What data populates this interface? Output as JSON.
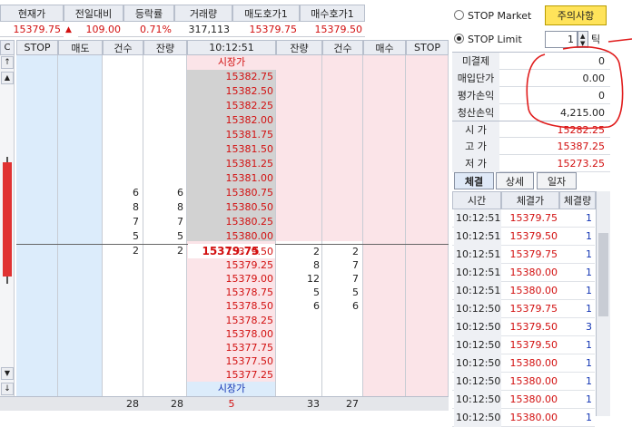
{
  "summary": {
    "headers": [
      "현재가",
      "전일대비",
      "등락률",
      "거래량",
      "매도호가1",
      "매수호가1"
    ],
    "current_price": "15379.75",
    "change_arrow": "▲",
    "change": "109.00",
    "change_rate": "0.71%",
    "volume": "317,113",
    "ask1": "15379.75",
    "bid1": "15379.50"
  },
  "controls": {
    "stop_market": "STOP Market",
    "stop_limit": "STOP Limit",
    "notice_button": "주의사항",
    "tick_value": "1",
    "tick_unit": "틱"
  },
  "orderbook": {
    "c_button": "C",
    "columns": [
      "STOP",
      "매도",
      "건수",
      "잔량",
      "10:12:51",
      "잔량",
      "건수",
      "매수",
      "STOP"
    ],
    "market_price_top": "시장가",
    "market_price_bottom": "시장가",
    "ask_rows": [
      {
        "price": "15382.75",
        "count": "",
        "qty": ""
      },
      {
        "price": "15382.50",
        "count": "",
        "qty": ""
      },
      {
        "price": "15382.25",
        "count": "",
        "qty": ""
      },
      {
        "price": "15382.00",
        "count": "",
        "qty": ""
      },
      {
        "price": "15381.75",
        "count": "",
        "qty": ""
      },
      {
        "price": "15381.50",
        "count": "",
        "qty": ""
      },
      {
        "price": "15381.25",
        "count": "",
        "qty": ""
      },
      {
        "price": "15381.00",
        "count": "",
        "qty": ""
      },
      {
        "price": "15380.75",
        "count": "6",
        "qty": "6"
      },
      {
        "price": "15380.50",
        "count": "8",
        "qty": "8"
      },
      {
        "price": "15380.25",
        "count": "7",
        "qty": "7"
      },
      {
        "price": "15380.00",
        "count": "5",
        "qty": "5"
      },
      {
        "price": "15379.75",
        "count": "2",
        "qty": "2"
      }
    ],
    "bid_rows": [
      {
        "price": "15379.50",
        "qty": "2",
        "count": "2"
      },
      {
        "price": "15379.25",
        "qty": "8",
        "count": "7"
      },
      {
        "price": "15379.00",
        "qty": "12",
        "count": "7"
      },
      {
        "price": "15378.75",
        "qty": "5",
        "count": "5"
      },
      {
        "price": "15378.50",
        "qty": "6",
        "count": "6"
      },
      {
        "price": "15378.25",
        "qty": "",
        "count": ""
      },
      {
        "price": "15378.00",
        "qty": "",
        "count": ""
      },
      {
        "price": "15377.75",
        "qty": "",
        "count": ""
      },
      {
        "price": "15377.50",
        "qty": "",
        "count": ""
      },
      {
        "price": "15377.25",
        "qty": "",
        "count": ""
      }
    ],
    "totals": {
      "ask_count": "28",
      "ask_qty": "28",
      "diff": "5",
      "bid_qty": "33",
      "bid_count": "27"
    }
  },
  "position": {
    "unfilled_label": "미결제",
    "unfilled": "0",
    "avg_price_label": "매입단가",
    "avg_price": "0.00",
    "eval_pl_label": "평가손익",
    "eval_pl": "0",
    "realized_pl_label": "청산손익",
    "realized_pl": "4,215.00"
  },
  "ohlc": {
    "open_label": "시 가",
    "open": "15282.25",
    "high_label": "고 가",
    "high": "15387.25",
    "low_label": "저 가",
    "low": "15273.25"
  },
  "tabs": [
    "체결",
    "상세",
    "일자"
  ],
  "trades": {
    "headers": [
      "시간",
      "체결가",
      "체결량"
    ],
    "rows": [
      {
        "time": "10:12:51",
        "price": "15379.75",
        "qty": "1",
        "side": "buy"
      },
      {
        "time": "10:12:51",
        "price": "15379.50",
        "qty": "1",
        "side": "sell"
      },
      {
        "time": "10:12:51",
        "price": "15379.75",
        "qty": "1",
        "side": "buy"
      },
      {
        "time": "10:12:51",
        "price": "15380.00",
        "qty": "1",
        "side": "buy"
      },
      {
        "time": "10:12:51",
        "price": "15380.00",
        "qty": "1",
        "side": "buy"
      },
      {
        "time": "10:12:50",
        "price": "15379.75",
        "qty": "1",
        "side": "buy"
      },
      {
        "time": "10:12:50",
        "price": "15379.50",
        "qty": "3",
        "side": "sell"
      },
      {
        "time": "10:12:50",
        "price": "15379.50",
        "qty": "1",
        "side": "sell"
      },
      {
        "time": "10:12:50",
        "price": "15380.00",
        "qty": "1",
        "side": "buy"
      },
      {
        "time": "10:12:50",
        "price": "15380.00",
        "qty": "1",
        "side": "buy"
      },
      {
        "time": "10:12:50",
        "price": "15380.00",
        "qty": "1",
        "side": "buy"
      },
      {
        "time": "10:12:50",
        "price": "15380.00",
        "qty": "1",
        "side": "buy"
      }
    ]
  },
  "colors": {
    "up": "#d21010",
    "down": "#1436b4",
    "ask_bg": "#dcecfb",
    "bid_bg": "#fbe4e8",
    "annotation": "#e01b1b"
  }
}
